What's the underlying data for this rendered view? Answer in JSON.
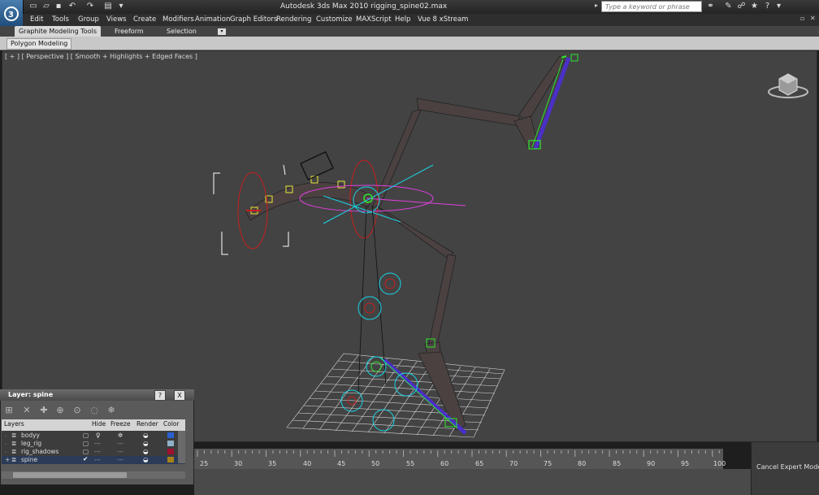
{
  "app": {
    "title": "Autodesk 3ds Max  2010      rigging_spine02.max",
    "logo": "3ds-max-logo"
  },
  "search": {
    "placeholder": "Type a keyword or phrase"
  },
  "menu": [
    "Edit",
    "Tools",
    "Group",
    "Views",
    "Create",
    "Modifiers",
    "Animation",
    "Graph Editors",
    "Rendering",
    "Customize",
    "MAXScript",
    "Help",
    "Vue 8 xStream"
  ],
  "ribbon": {
    "tabs": [
      "Graphite Modeling Tools",
      "Freeform",
      "Selection"
    ],
    "panel_label": "Polygon Modeling"
  },
  "viewport": {
    "label": "[ + ] [ Perspective ] [ Smooth + Highlights + Edged Faces ]"
  },
  "layer_dialog": {
    "title": "Layer: spine",
    "help_label": "?",
    "close_label": "X",
    "columns": [
      "Layers",
      "Hide",
      "Freeze",
      "Render",
      "Color"
    ],
    "rows": [
      {
        "name": "bodyy",
        "color": "#2a5fd0"
      },
      {
        "name": "leg_rig",
        "color": "#8fb0c8"
      },
      {
        "name": "rig_shadows",
        "color": "#a01030"
      },
      {
        "name": "spine",
        "color": "#a8801a"
      }
    ]
  },
  "timeline": {
    "ticks": [
      "25",
      "30",
      "35",
      "40",
      "45",
      "50",
      "55",
      "60",
      "65",
      "70",
      "75",
      "80",
      "85",
      "90",
      "95",
      "100"
    ]
  },
  "status": {
    "cancel_expert_mode": "Cancel Expert Mode"
  },
  "colors": {
    "viewport_bg": "#434343",
    "bone_blue": "#4a2fc8",
    "helper_cyan": "#19d5e8",
    "helper_red": "#c81e1e",
    "helper_magenta": "#e040e0",
    "selected_green": "#2ee82e",
    "bone_dark": "#4b4141"
  }
}
